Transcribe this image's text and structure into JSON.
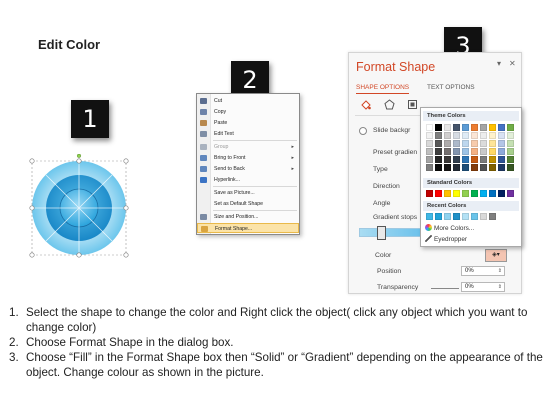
{
  "title": "Edit Color",
  "step_markers": [
    "1",
    "2",
    "3"
  ],
  "context_menu": {
    "items": [
      {
        "label": "Cut",
        "icon": "scissors-icon",
        "color": "#5b6d8f",
        "disabled": false,
        "submenu": false
      },
      {
        "label": "Copy",
        "icon": "copy-icon",
        "color": "#6d83a9",
        "disabled": false,
        "submenu": false
      },
      {
        "label": "Paste",
        "icon": "paste-icon",
        "color": "#b8884d",
        "disabled": false,
        "submenu": false
      },
      {
        "label": "Edit Text",
        "icon": "edit-text-icon",
        "color": "#7f8fa6",
        "disabled": false,
        "submenu": false
      },
      {
        "label": "Group",
        "icon": "group-icon",
        "color": "#a9b2bf",
        "disabled": true,
        "submenu": true
      },
      {
        "label": "Bring to Front",
        "icon": "bring-to-front-icon",
        "color": "#5f86bd",
        "disabled": false,
        "submenu": true
      },
      {
        "label": "Send to Back",
        "icon": "send-to-back-icon",
        "color": "#5f86bd",
        "disabled": false,
        "submenu": true
      },
      {
        "label": "Hyperlink...",
        "icon": "hyperlink-icon",
        "color": "#3b73c4",
        "disabled": false,
        "submenu": false
      },
      {
        "label": "Save as Picture...",
        "icon": "",
        "color": "",
        "disabled": false,
        "submenu": false
      },
      {
        "label": "Set as Default Shape",
        "icon": "",
        "color": "",
        "disabled": false,
        "submenu": false
      },
      {
        "label": "Size and Position...",
        "icon": "size-position-icon",
        "color": "#7a8aa3",
        "disabled": false,
        "submenu": false
      },
      {
        "label": "Format Shape...",
        "icon": "format-shape-icon",
        "color": "#d9a441",
        "disabled": false,
        "submenu": false,
        "highlighted": true
      }
    ]
  },
  "format_panel": {
    "title": "Format Shape",
    "tabs": [
      "SHAPE OPTIONS",
      "TEXT OPTIONS"
    ],
    "fields": {
      "slide_background": "Slide backgr",
      "preset_gradient": "Preset gradien",
      "type": "Type",
      "direction": "Direction",
      "angle": "Angle",
      "gradient_stops": "Gradient stops",
      "color": "Color",
      "position": "Position",
      "position_value": "0%",
      "transparency": "Transparency",
      "transparency_value": "0%"
    }
  },
  "color_popup": {
    "theme_header": "Theme Colors",
    "theme_colors": [
      [
        "#ffffff",
        "#000000",
        "#e7e6e6",
        "#44546a",
        "#5b9bd5",
        "#ed7d31",
        "#a5a5a5",
        "#ffc000",
        "#4472c4",
        "#70ad47"
      ],
      [
        "#f2f2f2",
        "#7f7f7f",
        "#d0cece",
        "#d6dce4",
        "#deebf6",
        "#fbe5d5",
        "#ededed",
        "#fff2cc",
        "#d9e2f3",
        "#e2efd9"
      ],
      [
        "#d8d8d8",
        "#595959",
        "#aeabab",
        "#adb9ca",
        "#bdd7ee",
        "#f7cbac",
        "#dbdbdb",
        "#fee599",
        "#b4c6e7",
        "#c5e0b3"
      ],
      [
        "#bfbfbf",
        "#3f3f3f",
        "#757070",
        "#8496b0",
        "#9dc3e6",
        "#f4b183",
        "#c9c9c9",
        "#ffd965",
        "#8eaadb",
        "#a8d08d"
      ],
      [
        "#a5a5a5",
        "#262626",
        "#3a3838",
        "#323f4f",
        "#2e75b5",
        "#c55a11",
        "#7b7b7b",
        "#bf9000",
        "#2f5496",
        "#538135"
      ],
      [
        "#7f7f7f",
        "#0c0c0c",
        "#171616",
        "#222a35",
        "#1e4e79",
        "#833c0b",
        "#525252",
        "#7f6000",
        "#1f3864",
        "#375623"
      ]
    ],
    "standard_header": "Standard Colors",
    "standard_colors": [
      "#c00000",
      "#ff0000",
      "#ffc000",
      "#ffff00",
      "#92d050",
      "#00b050",
      "#00b0f0",
      "#0070c0",
      "#002060",
      "#7030a0"
    ],
    "recent_header": "Recent Colors",
    "recent_colors": [
      "#3fb8e6",
      "#20a3d8",
      "#8fd3f0",
      "#1e90c8",
      "#b3e1f5",
      "#6ac4ea",
      "#d9d9d9",
      "#7f7f7f"
    ],
    "more_colors": "More Colors...",
    "eyedropper": "Eyedropper"
  },
  "instructions": [
    {
      "n": "1.",
      "text": "Select the shape to change the color and Right click the object( click any object which you want to change color)"
    },
    {
      "n": "2.",
      "text": "Choose Format Shape in the dialog box."
    },
    {
      "n": "3.",
      "text": "Choose “Fill” in the Format Shape box then “Solid” or “Gradient” depending on the appearance of the object. Change colour as shown in the picture."
    }
  ]
}
